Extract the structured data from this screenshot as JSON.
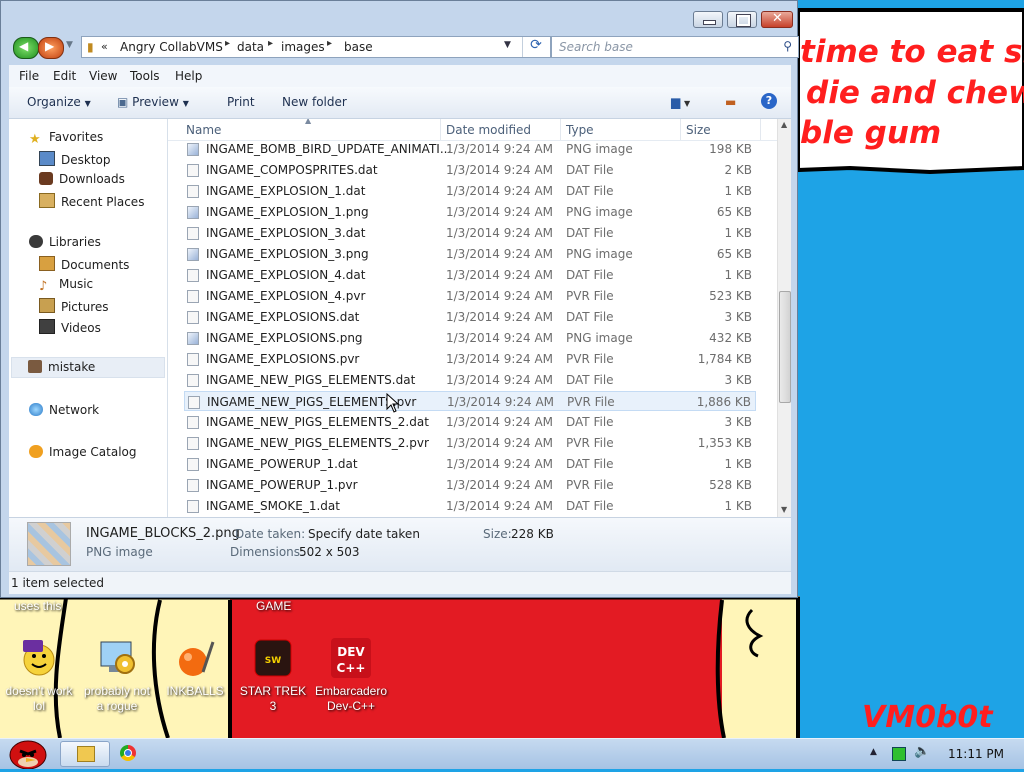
{
  "desktop": {
    "bubble_lines": [
      "time to eat shit",
      "die and chew",
      "ble gum"
    ],
    "labels": [
      "uses this",
      "GAME"
    ],
    "signature": "VM0b0t",
    "icons": [
      {
        "label": "doesn't work lol",
        "icon": "yahoo-messenger-icon"
      },
      {
        "label": "probably not a rogue",
        "icon": "gear-monitor-icon"
      },
      {
        "label": "INKBALLS",
        "icon": "inkball-icon"
      },
      {
        "label": "STAR TREK 3",
        "icon": "star-wars-icon"
      },
      {
        "label": "Embarcadero Dev-C++",
        "icon": "devcpp-icon"
      }
    ]
  },
  "window": {
    "breadcrumb": [
      "Angry CollabVMS",
      "data",
      "images",
      "base"
    ],
    "search_placeholder": "Search base",
    "menu": [
      "File",
      "Edit",
      "View",
      "Tools",
      "Help"
    ],
    "toolbar": {
      "organize": "Organize",
      "preview": "Preview",
      "print": "Print",
      "new_folder": "New folder"
    },
    "nav": {
      "favorites": "Favorites",
      "favorites_items": [
        "Desktop",
        "Downloads",
        "Recent Places"
      ],
      "libraries": "Libraries",
      "libraries_items": [
        "Documents",
        "Music",
        "Pictures",
        "Videos"
      ],
      "mistake": "mistake",
      "network": "Network",
      "image_catalog": "Image Catalog"
    },
    "columns": [
      "Name",
      "Date modified",
      "Type",
      "Size"
    ],
    "files": [
      {
        "name": "INGAME_BOMB_BIRD_UPDATE_ANIMATI...",
        "date": "1/3/2014 9:24 AM",
        "type": "PNG image",
        "size": "198 KB"
      },
      {
        "name": "INGAME_COMPOSPRITES.dat",
        "date": "1/3/2014 9:24 AM",
        "type": "DAT File",
        "size": "2 KB"
      },
      {
        "name": "INGAME_EXPLOSION_1.dat",
        "date": "1/3/2014 9:24 AM",
        "type": "DAT File",
        "size": "1 KB"
      },
      {
        "name": "INGAME_EXPLOSION_1.png",
        "date": "1/3/2014 9:24 AM",
        "type": "PNG image",
        "size": "65 KB"
      },
      {
        "name": "INGAME_EXPLOSION_3.dat",
        "date": "1/3/2014 9:24 AM",
        "type": "DAT File",
        "size": "1 KB"
      },
      {
        "name": "INGAME_EXPLOSION_3.png",
        "date": "1/3/2014 9:24 AM",
        "type": "PNG image",
        "size": "65 KB"
      },
      {
        "name": "INGAME_EXPLOSION_4.dat",
        "date": "1/3/2014 9:24 AM",
        "type": "DAT File",
        "size": "1 KB"
      },
      {
        "name": "INGAME_EXPLOSION_4.pvr",
        "date": "1/3/2014 9:24 AM",
        "type": "PVR File",
        "size": "523 KB"
      },
      {
        "name": "INGAME_EXPLOSIONS.dat",
        "date": "1/3/2014 9:24 AM",
        "type": "DAT File",
        "size": "3 KB"
      },
      {
        "name": "INGAME_EXPLOSIONS.png",
        "date": "1/3/2014 9:24 AM",
        "type": "PNG image",
        "size": "432 KB"
      },
      {
        "name": "INGAME_EXPLOSIONS.pvr",
        "date": "1/3/2014 9:24 AM",
        "type": "PVR File",
        "size": "1,784 KB"
      },
      {
        "name": "INGAME_NEW_PIGS_ELEMENTS.dat",
        "date": "1/3/2014 9:24 AM",
        "type": "DAT File",
        "size": "3 KB"
      },
      {
        "name": "INGAME_NEW_PIGS_ELEMENTS.pvr",
        "date": "1/3/2014 9:24 AM",
        "type": "PVR File",
        "size": "1,886 KB"
      },
      {
        "name": "INGAME_NEW_PIGS_ELEMENTS_2.dat",
        "date": "1/3/2014 9:24 AM",
        "type": "DAT File",
        "size": "3 KB"
      },
      {
        "name": "INGAME_NEW_PIGS_ELEMENTS_2.pvr",
        "date": "1/3/2014 9:24 AM",
        "type": "PVR File",
        "size": "1,353 KB"
      },
      {
        "name": "INGAME_POWERUP_1.dat",
        "date": "1/3/2014 9:24 AM",
        "type": "DAT File",
        "size": "1 KB"
      },
      {
        "name": "INGAME_POWERUP_1.pvr",
        "date": "1/3/2014 9:24 AM",
        "type": "PVR File",
        "size": "528 KB"
      },
      {
        "name": "INGAME_SMOKE_1.dat",
        "date": "1/3/2014 9:24 AM",
        "type": "DAT File",
        "size": "1 KB"
      }
    ],
    "details": {
      "filename": "INGAME_BLOCKS_2.png",
      "filetype": "PNG image",
      "date_taken_label": "Date taken:",
      "date_taken_value": "Specify date taken",
      "dimensions_label": "Dimensions:",
      "dimensions_value": "502 x 503",
      "size_label": "Size:",
      "size_value": "228 KB"
    },
    "status": "1 item selected"
  },
  "taskbar": {
    "clock": "11:11 PM"
  },
  "colors": {
    "desktop_blue": "#1ea3e6",
    "red_panel": "#e31b23",
    "yellow_panel": "#fff5b8",
    "accent_red": "#ff1e1e"
  }
}
